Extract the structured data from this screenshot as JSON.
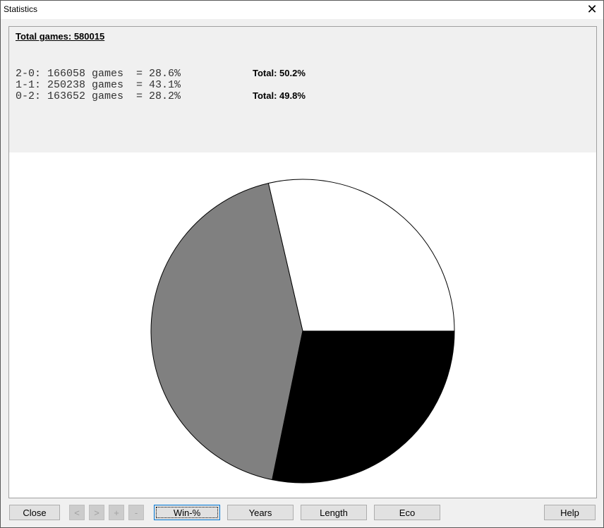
{
  "window": {
    "title": "Statistics"
  },
  "summary": {
    "total_games": "Total games: 580015",
    "lines": [
      "2-0: 166058 games  = 28.6%",
      "1-1: 250238 games  = 43.1%",
      "0-2: 163652 games  = 28.2%"
    ],
    "total_white": "Total: 50.2%",
    "total_black": "Total: 49.8%"
  },
  "buttons": {
    "close": "Close",
    "prev": "<",
    "next": ">",
    "plus": "+",
    "minus": "-",
    "win_pct": "Win-%",
    "years": "Years",
    "length": "Length",
    "eco": "Eco",
    "help": "Help"
  },
  "chart_data": {
    "type": "pie",
    "title": "",
    "categories": [
      "2-0",
      "1-1",
      "0-2"
    ],
    "values": [
      166058,
      250238,
      163652
    ],
    "percentages": [
      28.6,
      43.1,
      28.2
    ],
    "colors": [
      "#ffffff",
      "#808080",
      "#000000"
    ],
    "start_angle_deg": 0,
    "direction": "counterclockwise",
    "legend": "none"
  }
}
